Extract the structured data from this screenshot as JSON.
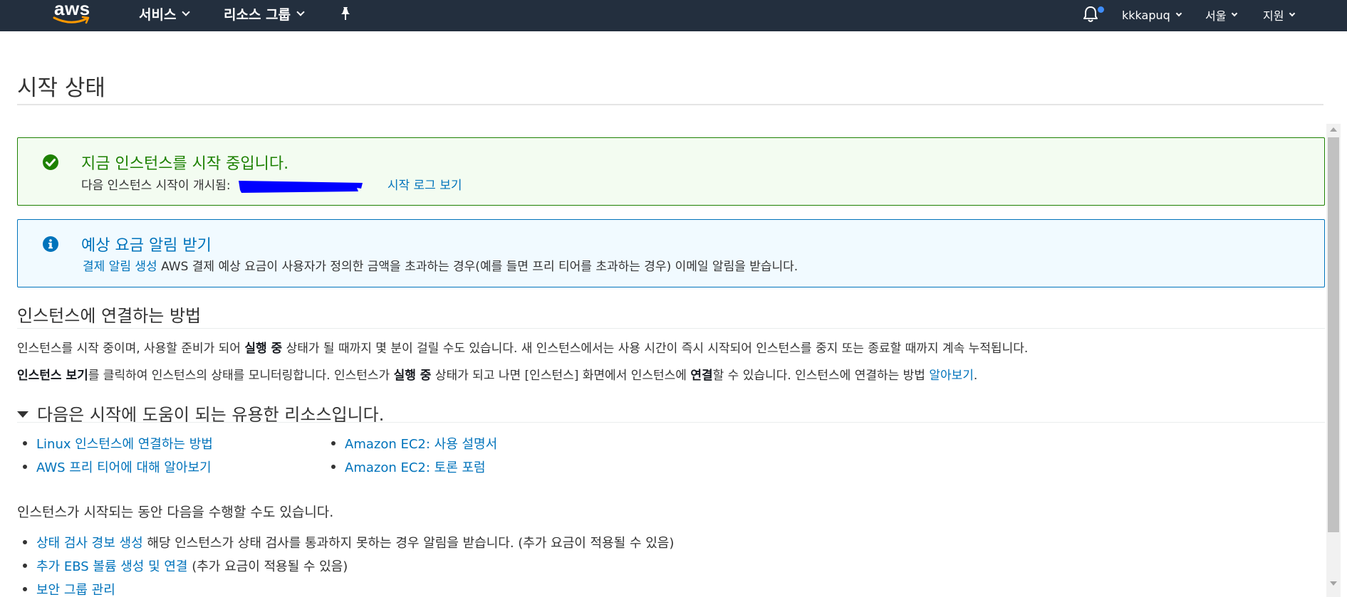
{
  "nav": {
    "logo_text": "aws",
    "services": "서비스",
    "resource_groups": "리소스 그룹",
    "username": "kkkapuq",
    "region": "서울",
    "support": "지원",
    "icons": [
      "pin-icon",
      "bell-icon"
    ],
    "colors": {
      "background": "#232f3e",
      "logo_smile": "#ff9900",
      "notification_dot": "#3f8df9"
    }
  },
  "page": {
    "title": "시작 상태"
  },
  "success_alert": {
    "title": "지금 인스턴스를 시작 중입니다.",
    "body": "다음 인스턴스 시작이 개시됨:",
    "link": "시작 로그 보기",
    "colors": {
      "accent": "#1d8102",
      "background": "#f3fcf1"
    }
  },
  "info_alert": {
    "title": "예상 요금 알림 받기",
    "link": "결제 알림 생성",
    "body": "AWS 결제 예상 요금이 사용자가 정의한 금액을 초과하는 경우(예를 들면 프리 티어를 초과하는 경우) 이메일 알림을 받습니다.",
    "colors": {
      "accent": "#0073bb",
      "background": "#f1faff"
    }
  },
  "connect_section": {
    "heading": "인스턴스에 연결하는 방법",
    "para1_a": "인스턴스를 시작 중이며, 사용할 준비가 되어",
    "para1_bold": "실행 중",
    "para1_b": "상태가 될 때까지 몇 분이 걸릴 수도 있습니다. 새 인스턴스에서는 사용 시간이 즉시 시작되어 인스턴스를 중지 또는 종료할 때까지 계속 누적됩니다.",
    "para2_bold1": "인스턴스 보기",
    "para2_a": "를 클릭하여 인스턴스의 상태를 모니터링합니다. 인스턴스가",
    "para2_bold2": "실행 중",
    "para2_b": "상태가 되고 나면 [인스턴스] 화면에서 인스턴스에",
    "para2_bold3": "연결",
    "para2_c": "할 수 있습니다. 인스턴스에 연결하는 방법",
    "para2_link": "알아보기",
    "para2_end": "."
  },
  "resources_section": {
    "heading": "다음은 시작에 도움이 되는 유용한 리소스입니다.",
    "left_links": [
      "Linux 인스턴스에 연결하는 방법",
      "AWS 프리 티어에 대해 알아보기"
    ],
    "right_links": [
      "Amazon EC2: 사용 설명서",
      "Amazon EC2: 토론 포럼"
    ]
  },
  "while_launching": {
    "intro": "인스턴스가 시작되는 동안 다음을 수행할 수도 있습니다.",
    "items": [
      {
        "link": "상태 검사 경보 생성",
        "text": "해당 인스턴스가 상태 검사를 통과하지 못하는 경우 알림을 받습니다. (추가 요금이 적용될 수 있음)"
      },
      {
        "link": "추가 EBS 볼륨 생성 및 연결",
        "text": "(추가 요금이 적용될 수 있음)"
      },
      {
        "link": "보안 그룹 관리",
        "text": ""
      }
    ]
  }
}
